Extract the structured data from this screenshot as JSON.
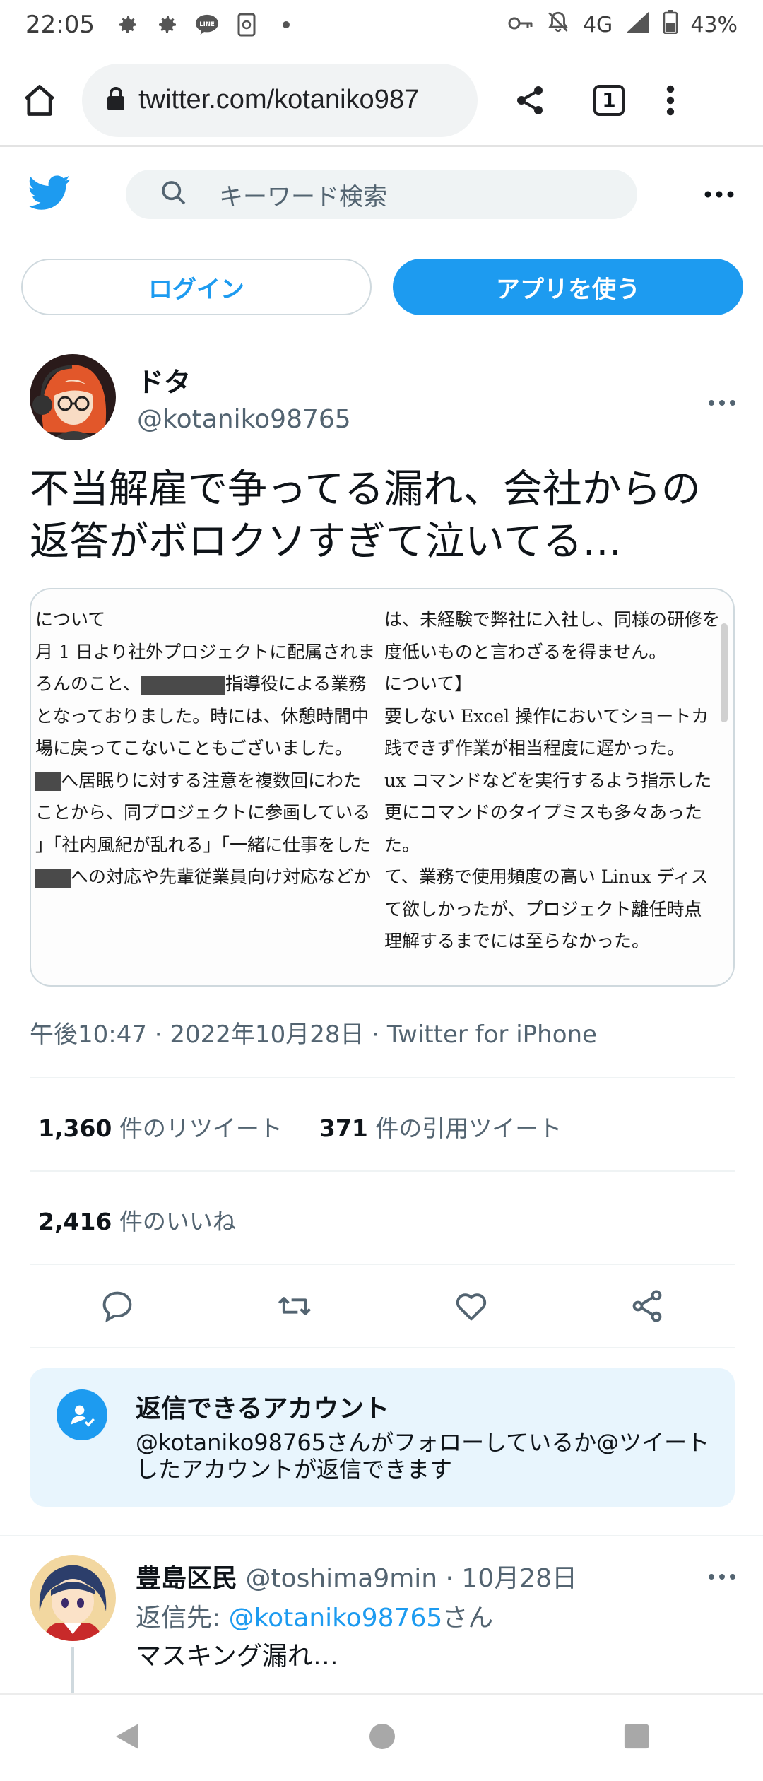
{
  "status_bar": {
    "time": "22:05",
    "network": "4G",
    "battery": "43%"
  },
  "browser": {
    "url": "twitter.com/kotaniko987",
    "tab_count": "1"
  },
  "twitter_header": {
    "search_placeholder": "キーワード検索"
  },
  "auth": {
    "login_label": "ログイン",
    "app_label": "アプリを使う"
  },
  "tweet": {
    "author_name": "ドタ",
    "author_handle": "@kotaniko98765",
    "text_line1": "不当解雇で争ってる漏れ、会社からの",
    "text_line2": "返答がボロクソすぎて泣いてる…",
    "meta": "午後10:47 · 2022年10月28日 · Twitter for iPhone",
    "retweet_count": "1,360",
    "retweet_label": "件のリツイート",
    "quote_count": "371",
    "quote_label": "件の引用ツイート",
    "like_count": "2,416",
    "like_label": "件のいいね"
  },
  "media_doc": {
    "left_lines": [
      "について",
      "月 1 日より社外プロジェクトに配属されま",
      "ろんのこと、",
      "指導役による業務",
      "となっておりました。時には、休憩時間中",
      "場に戻ってこないこともございました。",
      "へ居眠りに対する注意を複数回にわた",
      "ことから、同プロジェクトに参画している",
      "」「社内風紀が乱れる」「一緒に仕事をした",
      "への対応や先輩従業員向け対応などか"
    ],
    "right_lines": [
      "は、未経験で弊社に入社し、同様の研修を",
      "度低いものと言わざるを得ません。",
      "について】",
      "要しない Excel 操作においてショートカ",
      "践できず作業が相当程度に遅かった。",
      "ux コマンドなどを実行するよう指示した",
      "更にコマンドのタイプミスも多々あった",
      "た。",
      "て、業務で使用頻度の高い Linux ディス",
      "て欲しかったが、プロジェクト離任時点",
      "理解するまでには至らなかった。"
    ]
  },
  "reply_settings": {
    "title": "返信できるアカウント",
    "description": "@kotaniko98765さんがフォローしているか@ツイートしたアカウントが返信できます"
  },
  "reply": {
    "name": "豊島区民",
    "handle_date": "@toshima9min · 10月28日",
    "reply_to_prefix": "返信先: ",
    "reply_to_handle": "@kotaniko98765",
    "reply_to_suffix": "さん",
    "text": "マスキング漏れ…"
  },
  "colors": {
    "twitter_blue": "#1d9bf0",
    "secondary_text": "#536471",
    "reply_box_bg": "#e8f5fd"
  }
}
